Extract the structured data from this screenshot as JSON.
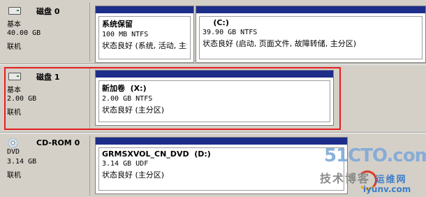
{
  "disks": [
    {
      "name": "磁盘 0",
      "type": "基本",
      "size": "40.00 GB",
      "state": "联机",
      "icon": "hard-disk-icon",
      "volumes": [
        {
          "title": "系统保留",
          "size": "100 MB NTFS",
          "status": "状态良好 (系统, 活动, 主分区)"
        },
        {
          "title": "    (C:)",
          "size": "39.90 GB NTFS",
          "status": "状态良好 (启动, 页面文件, 故障转储, 主分区)"
        }
      ]
    },
    {
      "name": "磁盘 1",
      "type": "基本",
      "size": "2.00 GB",
      "state": "联机",
      "icon": "hard-disk-icon",
      "volumes": [
        {
          "title": "新加卷  (X:)",
          "size": "2.00 GB NTFS",
          "status": "状态良好 (主分区)"
        }
      ]
    },
    {
      "name": "CD-ROM 0",
      "type": "DVD",
      "size": "3.14 GB",
      "state": "联机",
      "icon": "cd-rom-icon",
      "volumes": [
        {
          "title": "GRMSXVOL_CN_DVD  (D:)",
          "size": "3.14 GB UDF",
          "status": "状态良好 (主分区)"
        }
      ]
    }
  ],
  "watermark": {
    "line1": "51CTO.com",
    "line2": "技术博客",
    "line3": "iyunv.com",
    "line4": "运维网"
  },
  "colors": {
    "volume_bar": "#1d2d8a",
    "highlight": "#e41e1e",
    "background": "#d4d0c8"
  }
}
